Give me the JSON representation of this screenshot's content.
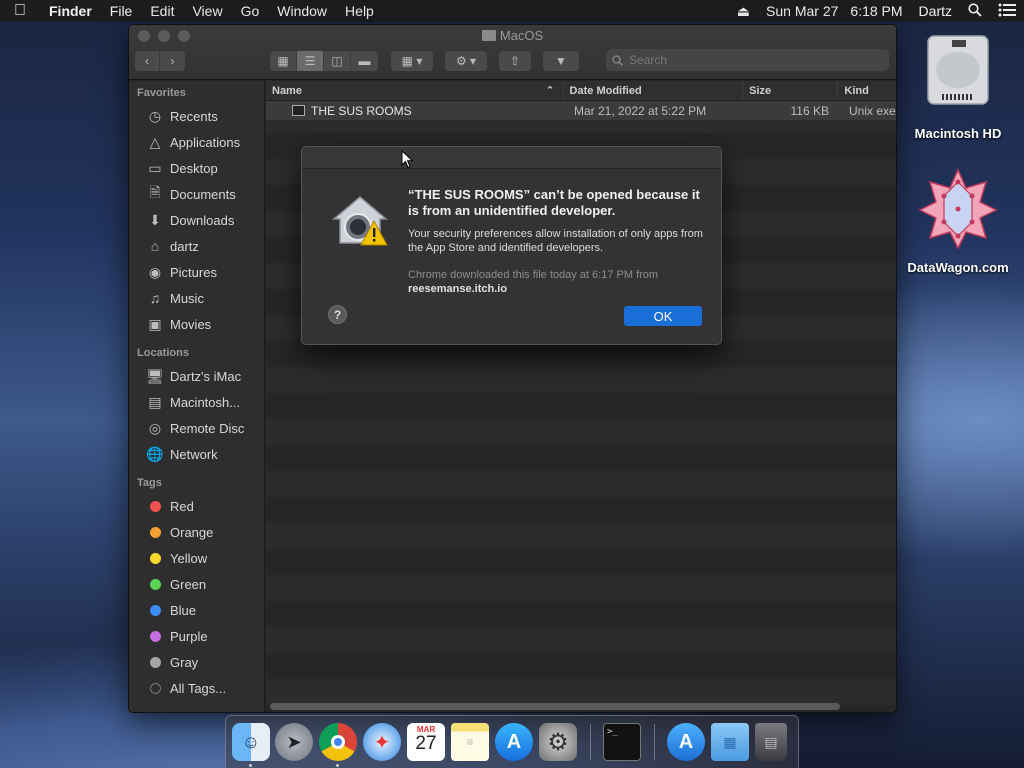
{
  "menubar": {
    "app_name": "Finder",
    "items": [
      "File",
      "Edit",
      "View",
      "Go",
      "Window",
      "Help"
    ],
    "date": "Sun Mar 27",
    "time": "6:18 PM",
    "user": "Dartz"
  },
  "window": {
    "title": "MacOS",
    "search_placeholder": "Search"
  },
  "sidebar": {
    "favorites_header": "Favorites",
    "favorites": [
      {
        "label": "Recents",
        "icon": "clock-icon"
      },
      {
        "label": "Applications",
        "icon": "applications-icon"
      },
      {
        "label": "Desktop",
        "icon": "desktop-icon"
      },
      {
        "label": "Documents",
        "icon": "document-icon"
      },
      {
        "label": "Downloads",
        "icon": "download-icon"
      },
      {
        "label": "dartz",
        "icon": "home-icon"
      },
      {
        "label": "Pictures",
        "icon": "camera-icon"
      },
      {
        "label": "Music",
        "icon": "music-note-icon"
      },
      {
        "label": "Movies",
        "icon": "film-icon"
      }
    ],
    "locations_header": "Locations",
    "locations": [
      {
        "label": "Dartz's iMac",
        "icon": "imac-icon"
      },
      {
        "label": "Macintosh...",
        "icon": "disk-icon"
      },
      {
        "label": "Remote Disc",
        "icon": "disc-icon"
      },
      {
        "label": "Network",
        "icon": "globe-icon"
      }
    ],
    "tags_header": "Tags",
    "tags": [
      {
        "label": "Red",
        "color": "#f0524f"
      },
      {
        "label": "Orange",
        "color": "#f5a033"
      },
      {
        "label": "Yellow",
        "color": "#f7d82b"
      },
      {
        "label": "Green",
        "color": "#5ad357"
      },
      {
        "label": "Blue",
        "color": "#3b8df5"
      },
      {
        "label": "Purple",
        "color": "#c46ee0"
      },
      {
        "label": "Gray",
        "color": "#a6a6a6"
      },
      {
        "label": "All Tags...",
        "color": "#555555"
      }
    ]
  },
  "columns": {
    "name": "Name",
    "date_modified": "Date Modified",
    "size": "Size",
    "kind": "Kind"
  },
  "files": [
    {
      "name": "THE SUS ROOMS",
      "date_modified": "Mar 21, 2022 at 5:22 PM",
      "size": "116 KB",
      "kind": "Unix executable"
    }
  ],
  "dialog": {
    "heading": "“THE SUS ROOMS” can’t be opened because it is from an unidentified developer.",
    "body": "Your security preferences allow installation of only apps from the App Store and identified developers.",
    "source_prefix": "Chrome downloaded this file today at 6:17 PM from",
    "source_host": "reesemanse.itch.io",
    "help_label": "?",
    "ok_label": "OK"
  },
  "desktop": {
    "items": [
      "Macintosh HD",
      "DataWagon.com"
    ]
  },
  "dock": {
    "calendar_month": "MAR",
    "calendar_day": "27"
  }
}
